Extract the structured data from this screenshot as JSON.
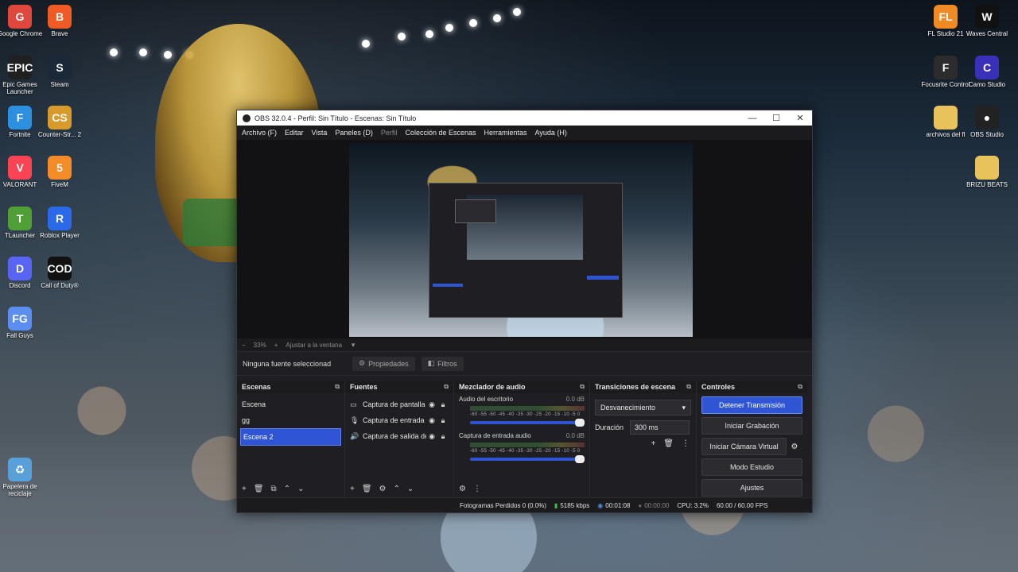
{
  "desktop": {
    "left_icons": [
      {
        "label": "Google Chrome",
        "color": "#e0483d",
        "glyph": "G"
      },
      {
        "label": "Brave",
        "color": "#f05a24",
        "glyph": "B"
      },
      {
        "label": "Epic Games Launcher",
        "color": "#202020",
        "glyph": "EPIC"
      },
      {
        "label": "Steam",
        "color": "#1b2838",
        "glyph": "S"
      },
      {
        "label": "Fortnite",
        "color": "#2d8fe0",
        "glyph": "F"
      },
      {
        "label": "Counter-Str... 2",
        "color": "#d89a2a",
        "glyph": "CS"
      },
      {
        "label": "VALORANT",
        "color": "#fa4454",
        "glyph": "V"
      },
      {
        "label": "FiveM",
        "color": "#f38b28",
        "glyph": "5"
      },
      {
        "label": "TLauncher",
        "color": "#4f9e36",
        "glyph": "T"
      },
      {
        "label": "Roblox Player",
        "color": "#2a6ae8",
        "glyph": "R"
      },
      {
        "label": "Discord",
        "color": "#5865f2",
        "glyph": "D"
      },
      {
        "label": "Call of Duty®",
        "color": "#111111",
        "glyph": "COD"
      },
      {
        "label": "Fall Guys",
        "color": "#5c8ef0",
        "glyph": "FG"
      },
      {
        "label": "Papelera de reciclaje",
        "color": "#5aa0d8",
        "glyph": "♻"
      }
    ],
    "right_icons": [
      {
        "label": "FL Studio 21",
        "color": "#f08a24",
        "glyph": "FL"
      },
      {
        "label": "Waves Central",
        "color": "#111111",
        "glyph": "W"
      },
      {
        "label": "Focusrite Control",
        "color": "#2c2c2c",
        "glyph": "F"
      },
      {
        "label": "Camo Studio",
        "color": "#3a2fb8",
        "glyph": "C"
      },
      {
        "label": "archivos del fl",
        "color": "#e8c25a",
        "glyph": ""
      },
      {
        "label": "OBS Studio",
        "color": "#222222",
        "glyph": "●"
      },
      {
        "label": "BRIZU BEATS",
        "color": "#e8c25a",
        "glyph": ""
      }
    ]
  },
  "obs": {
    "title": "OBS 32.0.4 - Perfil: Sin Título - Escenas: Sin Título",
    "window_buttons": {
      "minimize": "—",
      "maximize": "☐",
      "close": "✕"
    },
    "menu": [
      "Archivo (F)",
      "Editar",
      "Vista",
      "Paneles (D)",
      "Perfil",
      "Colección de Escenas",
      "Herramientas",
      "Ayuda (H)"
    ],
    "zoom": {
      "minus": "−",
      "level": "33%",
      "plus": "+",
      "fit": "Ajustar a la ventana",
      "arrow": "▼"
    },
    "source_toolbar": {
      "no_selection": "Ninguna fuente seleccionad",
      "properties": "Propiedades",
      "filters": "Filtros"
    },
    "scenes": {
      "title": "Escenas",
      "items": [
        "Escena",
        "gg",
        "Escena 2"
      ],
      "selected": "Escena 2",
      "footer": [
        "+",
        "🗑",
        "⧉",
        "⌃",
        "⌄"
      ]
    },
    "sources": {
      "title": "Fuentes",
      "items": [
        {
          "icon": "▭",
          "name": "Captura de pantalla"
        },
        {
          "icon": "🎙",
          "name": "Captura de entrada de audio"
        },
        {
          "icon": "🔊",
          "name": "Captura de salida de audio"
        }
      ],
      "footer": [
        "+",
        "🗑",
        "⚙",
        "⌃",
        "⌄"
      ]
    },
    "mixer": {
      "title": "Mezclador de audio",
      "channels": [
        {
          "name": "Audio del escritorio",
          "db": "0.0 dB"
        },
        {
          "name": "Captura de entrada audio",
          "db": "0.0 dB"
        }
      ],
      "scale": "-60 -55 -50 -45 -40 -35 -30 -25 -20 -15 -10 -5 0",
      "footer": [
        "⚙",
        "⋮"
      ]
    },
    "transitions": {
      "title": "Transiciones de escena",
      "selected": "Desvanecimiento",
      "duration_label": "Duración",
      "duration": "300 ms",
      "buttons": [
        "+",
        "🗑",
        "⋮"
      ]
    },
    "controls": {
      "title": "Controles",
      "buttons": [
        "Detener Transmisión",
        "Iniciar Grabación",
        "Iniciar Cámara Virtual",
        "Modo Estudio",
        "Ajustes"
      ],
      "active": "Detener Transmisión"
    },
    "status": {
      "dropped": "Fotogramas Perdidos 0 (0.0%)",
      "bitrate": "5185 kbps",
      "stream_time": "00:01:08",
      "rec_time": "00:00:00",
      "cpu": "CPU: 3.2%",
      "fps": "60.00 / 60.00 FPS"
    },
    "accent": "#2f55d4"
  }
}
